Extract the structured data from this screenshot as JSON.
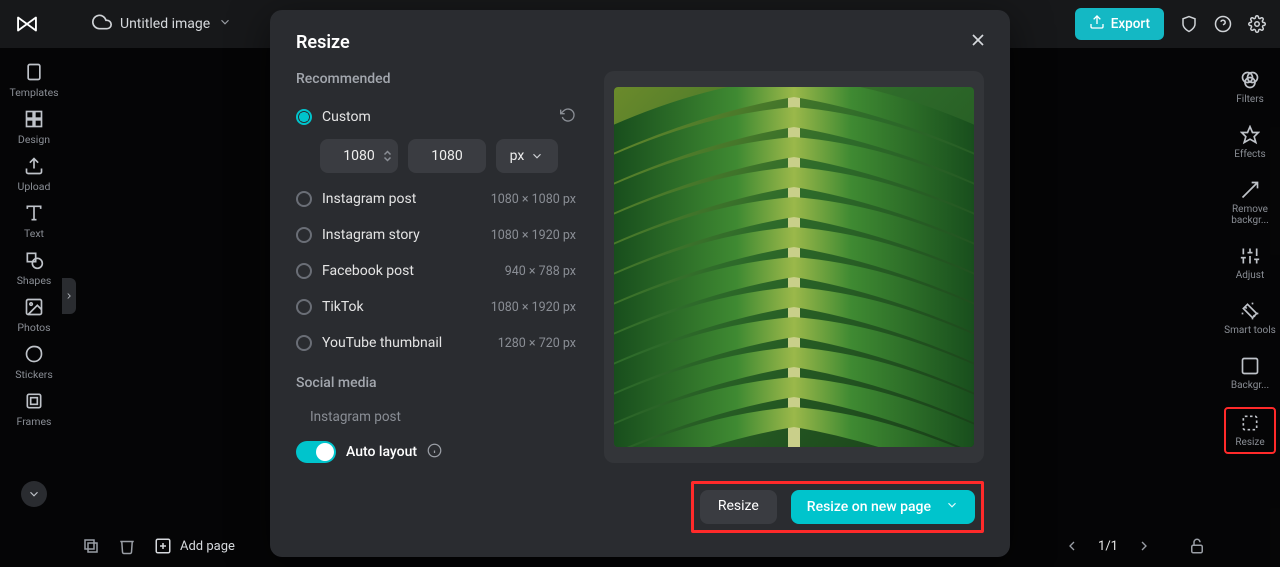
{
  "header": {
    "title": "Untitled image",
    "export_label": "Export"
  },
  "left_tools": {
    "templates": "Templates",
    "design": "Design",
    "upload": "Upload",
    "text": "Text",
    "shapes": "Shapes",
    "photos": "Photos",
    "stickers": "Stickers",
    "frames": "Frames"
  },
  "right_panel": {
    "filters": "Filters",
    "effects": "Effects",
    "remove_bg": "Remove backgr...",
    "adjust": "Adjust",
    "smart": "Smart tools",
    "backgr": "Backgr...",
    "resize": "Resize"
  },
  "bottombar": {
    "add_page": "Add page",
    "page_indicator": "1/1"
  },
  "modal": {
    "title": "Resize",
    "recommended_label": "Recommended",
    "custom_label": "Custom",
    "width": "1080",
    "height": "1080",
    "unit": "px",
    "presets": [
      {
        "label": "Instagram post",
        "size": "1080 × 1080 px"
      },
      {
        "label": "Instagram story",
        "size": "1080 × 1920 px"
      },
      {
        "label": "Facebook post",
        "size": "940 × 788 px"
      },
      {
        "label": "TikTok",
        "size": "1080 × 1920 px"
      },
      {
        "label": "YouTube thumbnail",
        "size": "1280 × 720 px"
      }
    ],
    "social_label": "Social media",
    "social_item": "Instagram post",
    "auto_layout": "Auto layout",
    "resize_btn": "Resize",
    "resize_new_btn": "Resize on new page"
  }
}
